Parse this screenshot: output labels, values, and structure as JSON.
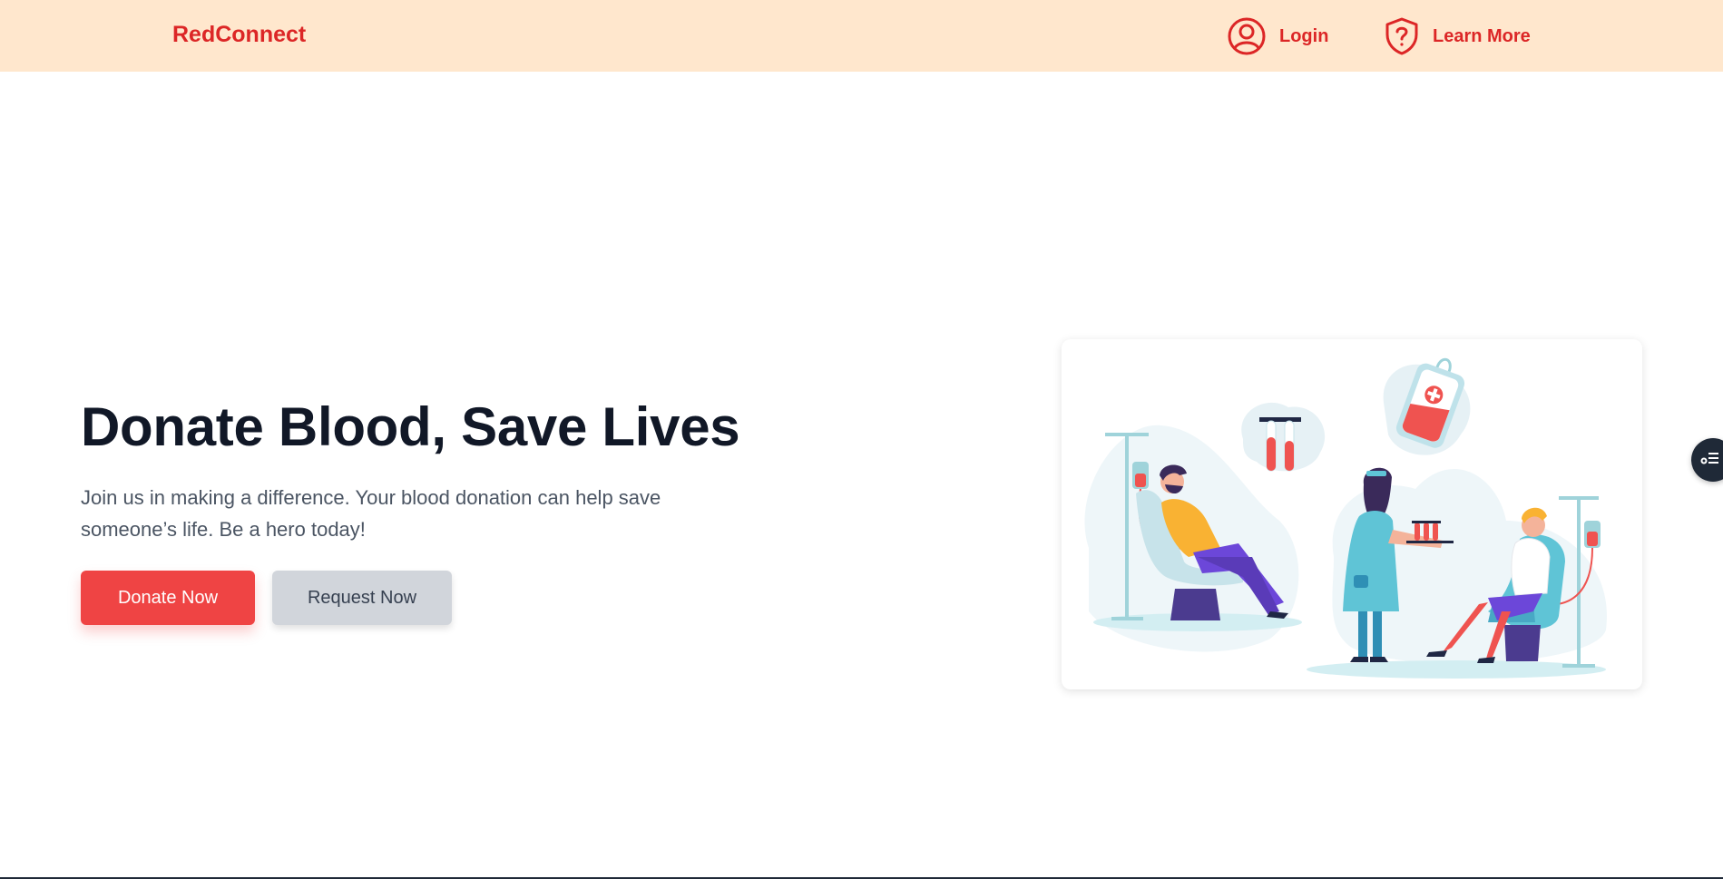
{
  "nav": {
    "brand": "RedConnect",
    "login_label": "Login",
    "learn_more_label": "Learn More",
    "login_icon": "user-circle-icon",
    "learn_more_icon": "shield-question-icon"
  },
  "hero": {
    "title": "Donate Blood, Save Lives",
    "subtitle": "Join us in making a difference. Your blood donation can help save someone’s life. Be a hero today!",
    "donate_label": "Donate Now",
    "request_label": "Request Now"
  },
  "illustration": {
    "description_icon": "blood-donation-illustration"
  },
  "widget": {
    "icon": "settings-list-icon"
  },
  "colors": {
    "brand_red": "#dc2626",
    "button_red": "#ef4444",
    "nav_bg": "#ffe7cd",
    "button_gray": "#d1d5db",
    "title_dark": "#111827"
  }
}
